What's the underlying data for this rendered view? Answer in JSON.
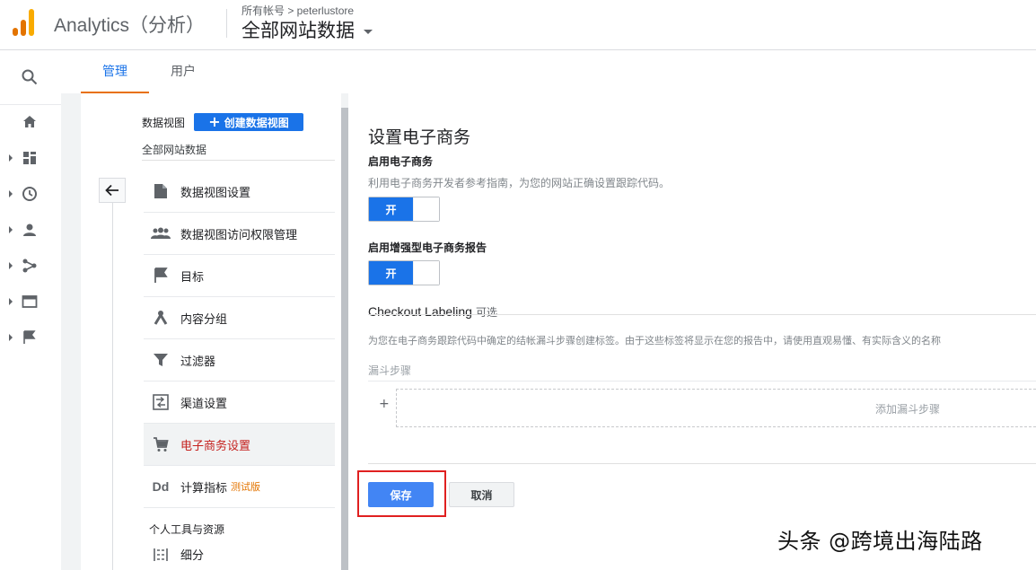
{
  "header": {
    "brand": "Analytics（分析）",
    "breadcrumb": "所有帐号 > peterlustore",
    "account_view": "全部网站数据"
  },
  "colors": {
    "logo_bars": [
      "#f9ab00",
      "#e37400",
      "#e37400"
    ],
    "accent": "#1a73e8",
    "active_tab_underline": "#e8710a",
    "highlight_box": "#e02020"
  },
  "tabs": [
    {
      "label": "管理",
      "active": true
    },
    {
      "label": "用户",
      "active": false
    }
  ],
  "rail": {
    "icons": [
      "search-icon",
      "home-icon",
      "dashboard-icon",
      "clock-icon",
      "person-icon",
      "acquisition-icon",
      "behavior-icon",
      "flag-icon"
    ]
  },
  "view_panel": {
    "title": "数据视图",
    "create_button": "创建数据视图",
    "current_view": "全部网站数据",
    "items": [
      {
        "label": "数据视图设置",
        "icon": "document-icon"
      },
      {
        "label": "数据视图访问权限管理",
        "icon": "people-icon"
      },
      {
        "label": "目标",
        "icon": "flag-icon"
      },
      {
        "label": "内容分组",
        "icon": "content-grouping-icon"
      },
      {
        "label": "过滤器",
        "icon": "filter-icon"
      },
      {
        "label": "渠道设置",
        "icon": "channel-settings-icon"
      },
      {
        "label": "电子商务设置",
        "icon": "cart-icon",
        "active": true
      },
      {
        "label": "计算指标",
        "icon": "calculated-metrics-icon",
        "badge": "测试版"
      }
    ],
    "section_title": "个人工具与资源",
    "section_items": [
      {
        "label": "细分",
        "icon": "segments-icon"
      }
    ]
  },
  "settings": {
    "title": "设置电子商务",
    "enable_ecommerce": {
      "label": "启用电子商务",
      "help": "利用电子商务开发者参考指南，为您的网站正确设置跟踪代码。",
      "toggle_label": "开"
    },
    "enhanced_ecommerce": {
      "label": "启用增强型电子商务报告",
      "toggle_label": "开"
    },
    "checkout_labeling": {
      "title": "Checkout Labeling",
      "optional": "可选",
      "help": "为您在电子商务跟踪代码中确定的结帐漏斗步骤创建标签。由于这些标签将显示在您的报告中，请使用直观易懂、有实际含义的名称",
      "funnel_label": "漏斗步骤",
      "add_plus": "+",
      "add_step": "添加漏斗步骤"
    },
    "save_button": "保存",
    "cancel_button": "取消"
  },
  "watermark": "头条 @跨境出海陆路"
}
